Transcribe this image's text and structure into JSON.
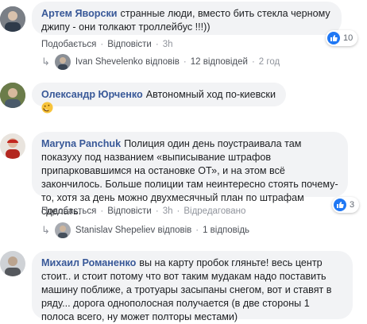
{
  "comments": [
    {
      "author": "Артем Яворски",
      "text": "странные люди, вместо бить стекла черному джипу - они толкают троллейбус !!!))",
      "actions": {
        "like": "Подобається",
        "reply": "Відповісти",
        "time": "3h"
      },
      "reactions": {
        "count": "10",
        "icon": "like-icon"
      },
      "reply_summary": {
        "who": "Ivan Shevelenko відповів",
        "count": "12 відповідей",
        "time": "2 год"
      }
    },
    {
      "author": "Олександр Юрченко",
      "text": "Автономный ход по-киевски",
      "emoji": "rofl-emoji"
    },
    {
      "author": "Maryna Panchuk",
      "text": "Полиция один день поустраивала там показуху под названием «выписывание штрафов припарковавшимся на остановке ОТ», и на этом всё закончилось. Больше полиции там неинтересно стоять почему-то, хотя за день можно двухмесячный план по штрафам сделать.",
      "actions": {
        "like": "Подобається",
        "reply": "Відповісти",
        "time": "3h",
        "edited": "Відредаговано"
      },
      "reactions": {
        "count": "3",
        "icon": "like-icon"
      },
      "reply_summary": {
        "who": "Stanislav Shepeliev відповів",
        "count": "1 відповідь"
      }
    },
    {
      "author": "Михаил Романенко",
      "text": "вы на карту пробок гляньте! весь центр стоит.. и стоит потому что вот таким мудакам надо поставить машину поближе, а тротуары засыпаны снегом, вот и ставят в ряду... дорога однополосная получается (в две стороны 1 полоса всего, ну может полторы местами)"
    }
  ],
  "colors": {
    "author": "#385898",
    "bubble": "#f2f3f5",
    "like": "#2078f4"
  }
}
